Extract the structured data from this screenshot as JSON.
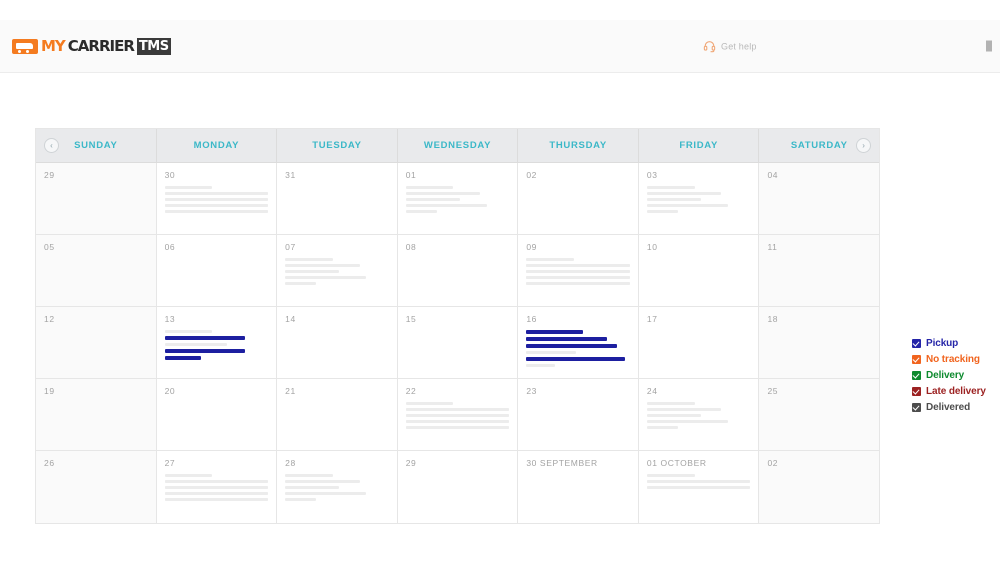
{
  "header": {
    "logo": {
      "my": "MY",
      "carrier": "CARRIER",
      "tms": "TMS",
      "icon": "truck-icon"
    },
    "get_help": {
      "label": "Get help",
      "icon": "headset-icon"
    }
  },
  "calendar": {
    "nav": {
      "prev": "‹",
      "next": "›"
    },
    "day_headers": [
      "SUNDAY",
      "MONDAY",
      "TUESDAY",
      "WEDNESDAY",
      "THURSDAY",
      "FRIDAY",
      "SATURDAY"
    ],
    "weeks": [
      [
        {
          "day": "29",
          "weekend": true,
          "bars": []
        },
        {
          "day": "30",
          "weekend": false,
          "bars": [
            [
              46
            ],
            [
              76,
              55
            ],
            [
              58,
              44
            ],
            [
              70,
              30
            ],
            [
              72,
              52
            ]
          ]
        },
        {
          "day": "31",
          "weekend": false,
          "bars": []
        },
        {
          "day": "01",
          "weekend": false,
          "bars": [
            [
              46
            ],
            [
              72
            ],
            [
              52
            ],
            [
              78
            ],
            [
              30
            ]
          ]
        },
        {
          "day": "02",
          "weekend": false,
          "bars": []
        },
        {
          "day": "03",
          "weekend": false,
          "bars": [
            [
              46
            ],
            [
              72
            ],
            [
              52
            ],
            [
              78
            ],
            [
              30
            ]
          ]
        },
        {
          "day": "04",
          "weekend": true,
          "bars": []
        }
      ],
      [
        {
          "day": "05",
          "weekend": true,
          "bars": []
        },
        {
          "day": "06",
          "weekend": false,
          "bars": []
        },
        {
          "day": "07",
          "weekend": false,
          "bars": [
            [
              46
            ],
            [
              72
            ],
            [
              52
            ],
            [
              78
            ],
            [
              30
            ]
          ]
        },
        {
          "day": "08",
          "weekend": false,
          "bars": []
        },
        {
          "day": "09",
          "weekend": false,
          "bars": [
            [
              46
            ],
            [
              76,
              55
            ],
            [
              58,
              44
            ],
            [
              70,
              30
            ],
            [
              72,
              52
            ]
          ]
        },
        {
          "day": "10",
          "weekend": false,
          "bars": []
        },
        {
          "day": "11",
          "weekend": true,
          "bars": []
        }
      ],
      [
        {
          "day": "12",
          "weekend": true,
          "bars": []
        },
        {
          "day": "13",
          "weekend": false,
          "bars": [
            [
              46
            ],
            [
              "blue",
              78
            ],
            [
              60
            ],
            [
              "blue",
              78
            ],
            [
              "blue",
              35
            ]
          ]
        },
        {
          "day": "14",
          "weekend": false,
          "bars": []
        },
        {
          "day": "15",
          "weekend": false,
          "bars": []
        },
        {
          "day": "16",
          "weekend": false,
          "bars": [
            [
              "blue",
              55
            ],
            [
              "blue",
              78
            ],
            [
              "blue",
              88
            ],
            [
              48
            ],
            [
              "blue",
              95
            ],
            [
              28
            ]
          ]
        },
        {
          "day": "17",
          "weekend": false,
          "bars": []
        },
        {
          "day": "18",
          "weekend": true,
          "bars": []
        }
      ],
      [
        {
          "day": "19",
          "weekend": true,
          "bars": []
        },
        {
          "day": "20",
          "weekend": false,
          "bars": []
        },
        {
          "day": "21",
          "weekend": false,
          "bars": []
        },
        {
          "day": "22",
          "weekend": false,
          "bars": [
            [
              46
            ],
            [
              76,
              55
            ],
            [
              58,
              44
            ],
            [
              70,
              30
            ],
            [
              72,
              52
            ]
          ]
        },
        {
          "day": "23",
          "weekend": false,
          "bars": []
        },
        {
          "day": "24",
          "weekend": false,
          "bars": [
            [
              46
            ],
            [
              72
            ],
            [
              52
            ],
            [
              78
            ],
            [
              30
            ]
          ]
        },
        {
          "day": "25",
          "weekend": true,
          "bars": []
        }
      ],
      [
        {
          "day": "26",
          "weekend": true,
          "bars": []
        },
        {
          "day": "27",
          "weekend": false,
          "bars": [
            [
              46
            ],
            [
              76,
              55
            ],
            [
              58,
              44
            ],
            [
              70,
              30
            ],
            [
              72,
              52
            ]
          ]
        },
        {
          "day": "28",
          "weekend": false,
          "bars": [
            [
              46
            ],
            [
              72
            ],
            [
              52
            ],
            [
              78
            ],
            [
              30
            ]
          ]
        },
        {
          "day": "29",
          "weekend": false,
          "bars": []
        },
        {
          "day": "30 SEPTEMBER",
          "weekend": false,
          "bars": []
        },
        {
          "day": "01 OCTOBER",
          "weekend": false,
          "bars": [
            [
              46
            ],
            [
              58,
              42
            ],
            [
              70,
              46
            ]
          ]
        },
        {
          "day": "02",
          "weekend": true,
          "bars": []
        }
      ]
    ]
  },
  "legend": {
    "items": [
      {
        "label": "Pickup",
        "color": "#2424a8"
      },
      {
        "label": "No tracking",
        "color": "#f1641e"
      },
      {
        "label": "Delivery",
        "color": "#0d8a2e"
      },
      {
        "label": "Late delivery",
        "color": "#9c2222"
      },
      {
        "label": "Delivered",
        "color": "#4d4d4d"
      }
    ]
  }
}
